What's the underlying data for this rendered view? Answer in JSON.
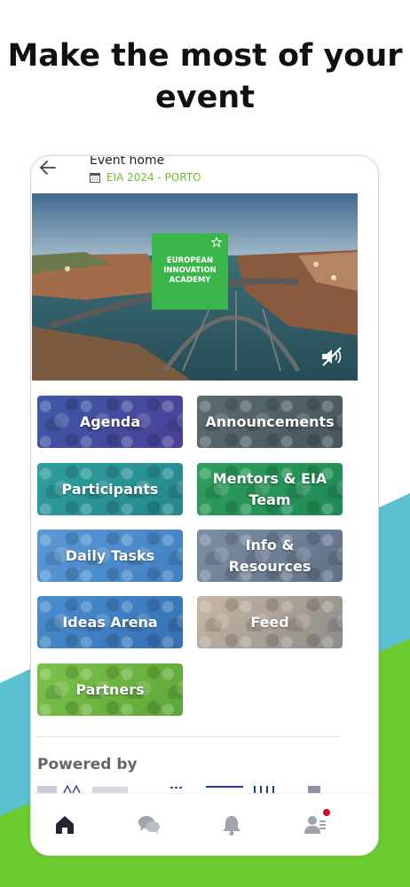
{
  "headline": "Make the most of your event",
  "header": {
    "title": "Event home",
    "event_name": "EIA 2024 - PORTO"
  },
  "hero": {
    "logo_lines": [
      "EUROPEAN",
      "INNOVATION",
      "ACADEMY"
    ],
    "mute_icon": "speaker-muted-icon"
  },
  "tiles": [
    {
      "label": "Agenda",
      "color": "#3c5aa8"
    },
    {
      "label": "Announcements",
      "color": "#5b6c70"
    },
    {
      "label": "Participants",
      "color": "#2e9e9e"
    },
    {
      "label": "Mentors & EIA Team",
      "color": "#2f9e5e"
    },
    {
      "label": "Daily Tasks",
      "color": "#5b9ad6"
    },
    {
      "label": "Info & Resources",
      "color": "#7d8fa3"
    },
    {
      "label": "Ideas Arena",
      "color": "#4a8fd0"
    },
    {
      "label": "Feed",
      "color": "#a89c90"
    },
    {
      "label": "Partners",
      "color": "#7dc24b"
    }
  ],
  "powered_by": "Powered by",
  "bottom_nav": [
    {
      "icon": "home-icon",
      "active": true
    },
    {
      "icon": "chat-icon",
      "active": false
    },
    {
      "icon": "bell-icon",
      "active": false
    },
    {
      "icon": "profile-icon",
      "active": false,
      "badge": true
    }
  ],
  "colors": {
    "accent_green": "#76b82a",
    "bg_teal": "#5bc0d0",
    "bg_green": "#6ccb2e",
    "notification": "#c8102e"
  }
}
